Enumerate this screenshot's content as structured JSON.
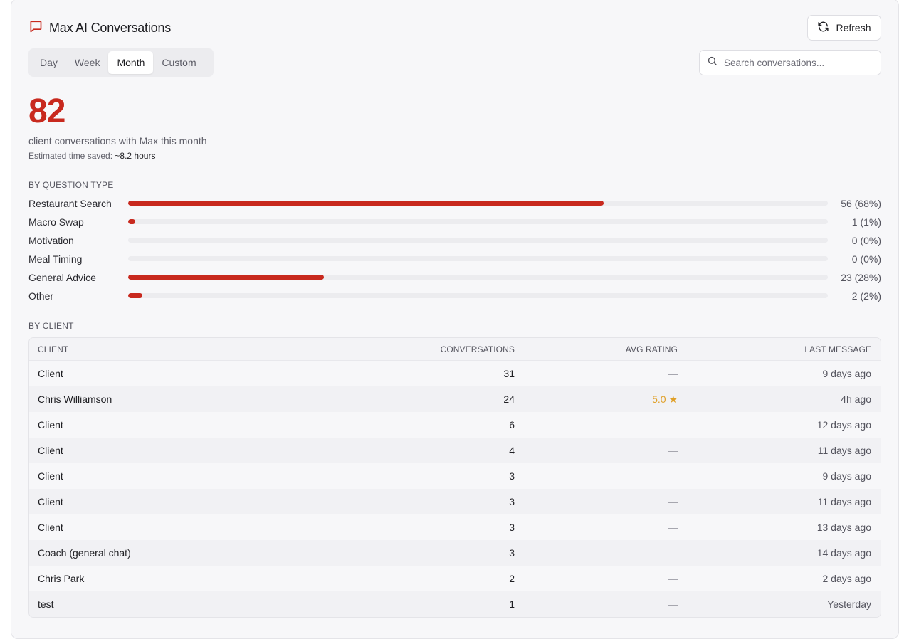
{
  "header": {
    "title": "Max AI Conversations",
    "refresh_label": "Refresh"
  },
  "tabs": [
    {
      "label": "Day",
      "active": false
    },
    {
      "label": "Week",
      "active": false
    },
    {
      "label": "Month",
      "active": true
    },
    {
      "label": "Custom",
      "active": false
    }
  ],
  "search": {
    "placeholder": "Search conversations...",
    "value": ""
  },
  "summary": {
    "count": "82",
    "description": "client conversations with Max this month",
    "saved_label": "Estimated time saved:",
    "saved_value": "~8.2 hours"
  },
  "question_types": {
    "section_label": "BY QUESTION TYPE",
    "items": [
      {
        "label": "Restaurant Search",
        "count": 56,
        "percent": 68,
        "value_text": "56 (68%)"
      },
      {
        "label": "Macro Swap",
        "count": 1,
        "percent": 1,
        "value_text": "1 (1%)"
      },
      {
        "label": "Motivation",
        "count": 0,
        "percent": 0,
        "value_text": "0 (0%)"
      },
      {
        "label": "Meal Timing",
        "count": 0,
        "percent": 0,
        "value_text": "0 (0%)"
      },
      {
        "label": "General Advice",
        "count": 23,
        "percent": 28,
        "value_text": "23 (28%)"
      },
      {
        "label": "Other",
        "count": 2,
        "percent": 2,
        "value_text": "2 (2%)"
      }
    ]
  },
  "clients": {
    "section_label": "BY CLIENT",
    "columns": [
      "CLIENT",
      "CONVERSATIONS",
      "AVG RATING",
      "LAST MESSAGE"
    ],
    "rows": [
      {
        "client": "Client",
        "conversations": "31",
        "rating": "—",
        "last": "9 days ago"
      },
      {
        "client": "Chris Williamson",
        "conversations": "24",
        "rating": "5.0 ★",
        "last": "4h ago"
      },
      {
        "client": "Client",
        "conversations": "6",
        "rating": "—",
        "last": "12 days ago"
      },
      {
        "client": "Client",
        "conversations": "4",
        "rating": "—",
        "last": "11 days ago"
      },
      {
        "client": "Client",
        "conversations": "3",
        "rating": "—",
        "last": "9 days ago"
      },
      {
        "client": "Client",
        "conversations": "3",
        "rating": "—",
        "last": "11 days ago"
      },
      {
        "client": "Client",
        "conversations": "3",
        "rating": "—",
        "last": "13 days ago"
      },
      {
        "client": "Coach (general chat)",
        "conversations": "3",
        "rating": "—",
        "last": "14 days ago"
      },
      {
        "client": "Chris Park",
        "conversations": "2",
        "rating": "—",
        "last": "2 days ago"
      },
      {
        "client": "test",
        "conversations": "1",
        "rating": "—",
        "last": "Yesterday"
      }
    ]
  },
  "colors": {
    "accent": "#c8291e",
    "star": "#e0a028"
  },
  "icons": {
    "title_icon": "chat-bubble-icon",
    "refresh_icon": "refresh-icon",
    "search_icon": "search-icon"
  }
}
